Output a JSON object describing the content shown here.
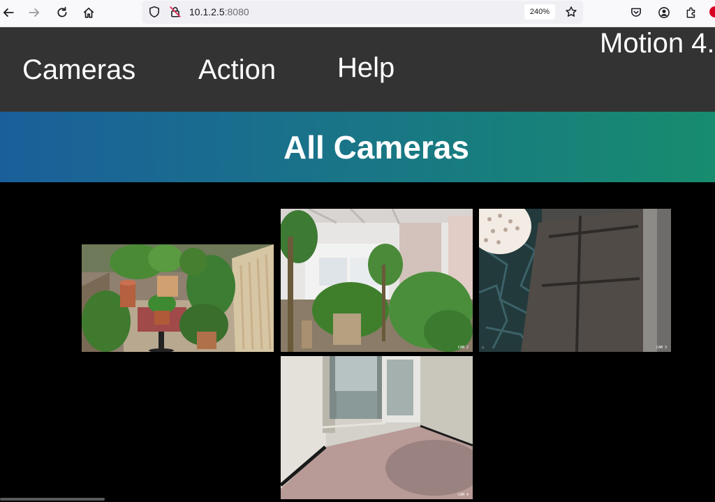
{
  "browser": {
    "url_host": "10.1.2.5",
    "url_port": ":8080",
    "zoom": "240%",
    "icons": [
      "back-arrow-icon",
      "forward-arrow-icon",
      "reload-icon",
      "home-icon",
      "shield-icon",
      "insecure-lock-icon",
      "star-icon",
      "pocket-icon",
      "account-icon",
      "extensions-icon"
    ]
  },
  "nav": {
    "items": [
      {
        "label": "Cameras"
      },
      {
        "label": "Action"
      },
      {
        "label": "Help"
      }
    ],
    "brand": "Motion 4."
  },
  "banner": {
    "title": "All Cameras"
  },
  "cameras": [
    {
      "name": "garden-terrace",
      "stamp": ""
    },
    {
      "name": "balcony-plants",
      "stamp": "CAM 2"
    },
    {
      "name": "dark-wall",
      "stamp": "CAM 3"
    },
    {
      "name": "hallway-door",
      "stamp": "CAM 4"
    }
  ],
  "colors": {
    "nav_bg": "#333333",
    "banner_start": "#1a5f9a",
    "banner_end": "#178c6e",
    "page_bg": "#000000"
  }
}
